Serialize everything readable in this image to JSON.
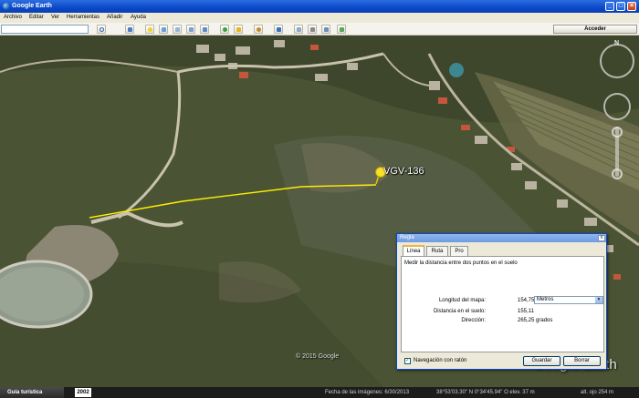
{
  "window": {
    "title": "Google Earth",
    "min_label": "_",
    "max_label": "□",
    "close_label": "×"
  },
  "menu": [
    "Archivo",
    "Editar",
    "Ver",
    "Herramientas",
    "Añadir",
    "Ayuda"
  ],
  "toolbar": {
    "search_value": "",
    "sign_in_label": "Acceder",
    "icons": [
      "search-icon",
      "sidebar-icon",
      "placemark-icon",
      "polygon-icon",
      "path-icon",
      "image-overlay-icon",
      "record-tour-icon",
      "historical-imagery-icon",
      "sun-icon",
      "planets-icon",
      "ruler-icon",
      "email-icon",
      "print-icon",
      "save-image-icon",
      "maps-icon"
    ]
  },
  "map": {
    "placemark_label": "VGV-136",
    "copyright": "© 2015 Google",
    "brand": "Google Earth",
    "path_color": "#ffee00"
  },
  "ruler_dialog": {
    "title": "Regla",
    "close_label": "x",
    "tabs": [
      "Línea",
      "Ruta",
      "Pro"
    ],
    "active_tab": "Línea",
    "description": "Medir la distancia entre dos puntos en el suelo",
    "map_length_label": "Longitud del mapa:",
    "map_length_value": "154,75",
    "unit": "Metros",
    "ground_length_label": "Distancia en el suelo:",
    "ground_length_value": "155,11",
    "heading_label": "Dirección:",
    "heading_value": "265,25 grados",
    "mouse_nav_label": "Navegación con ratón",
    "mouse_nav_checked": true,
    "save_label": "Guardar",
    "clear_label": "Borrar"
  },
  "statusbar": {
    "tour_label": "Guía turística",
    "year": "2002",
    "imagery_date": "Fecha de las imágenes: 6/30/2013",
    "coords": "38°53'03.30\" N    0°34'45.94\" O   elev.   37 m",
    "eye_alt": "alt. ojo   254 m"
  }
}
